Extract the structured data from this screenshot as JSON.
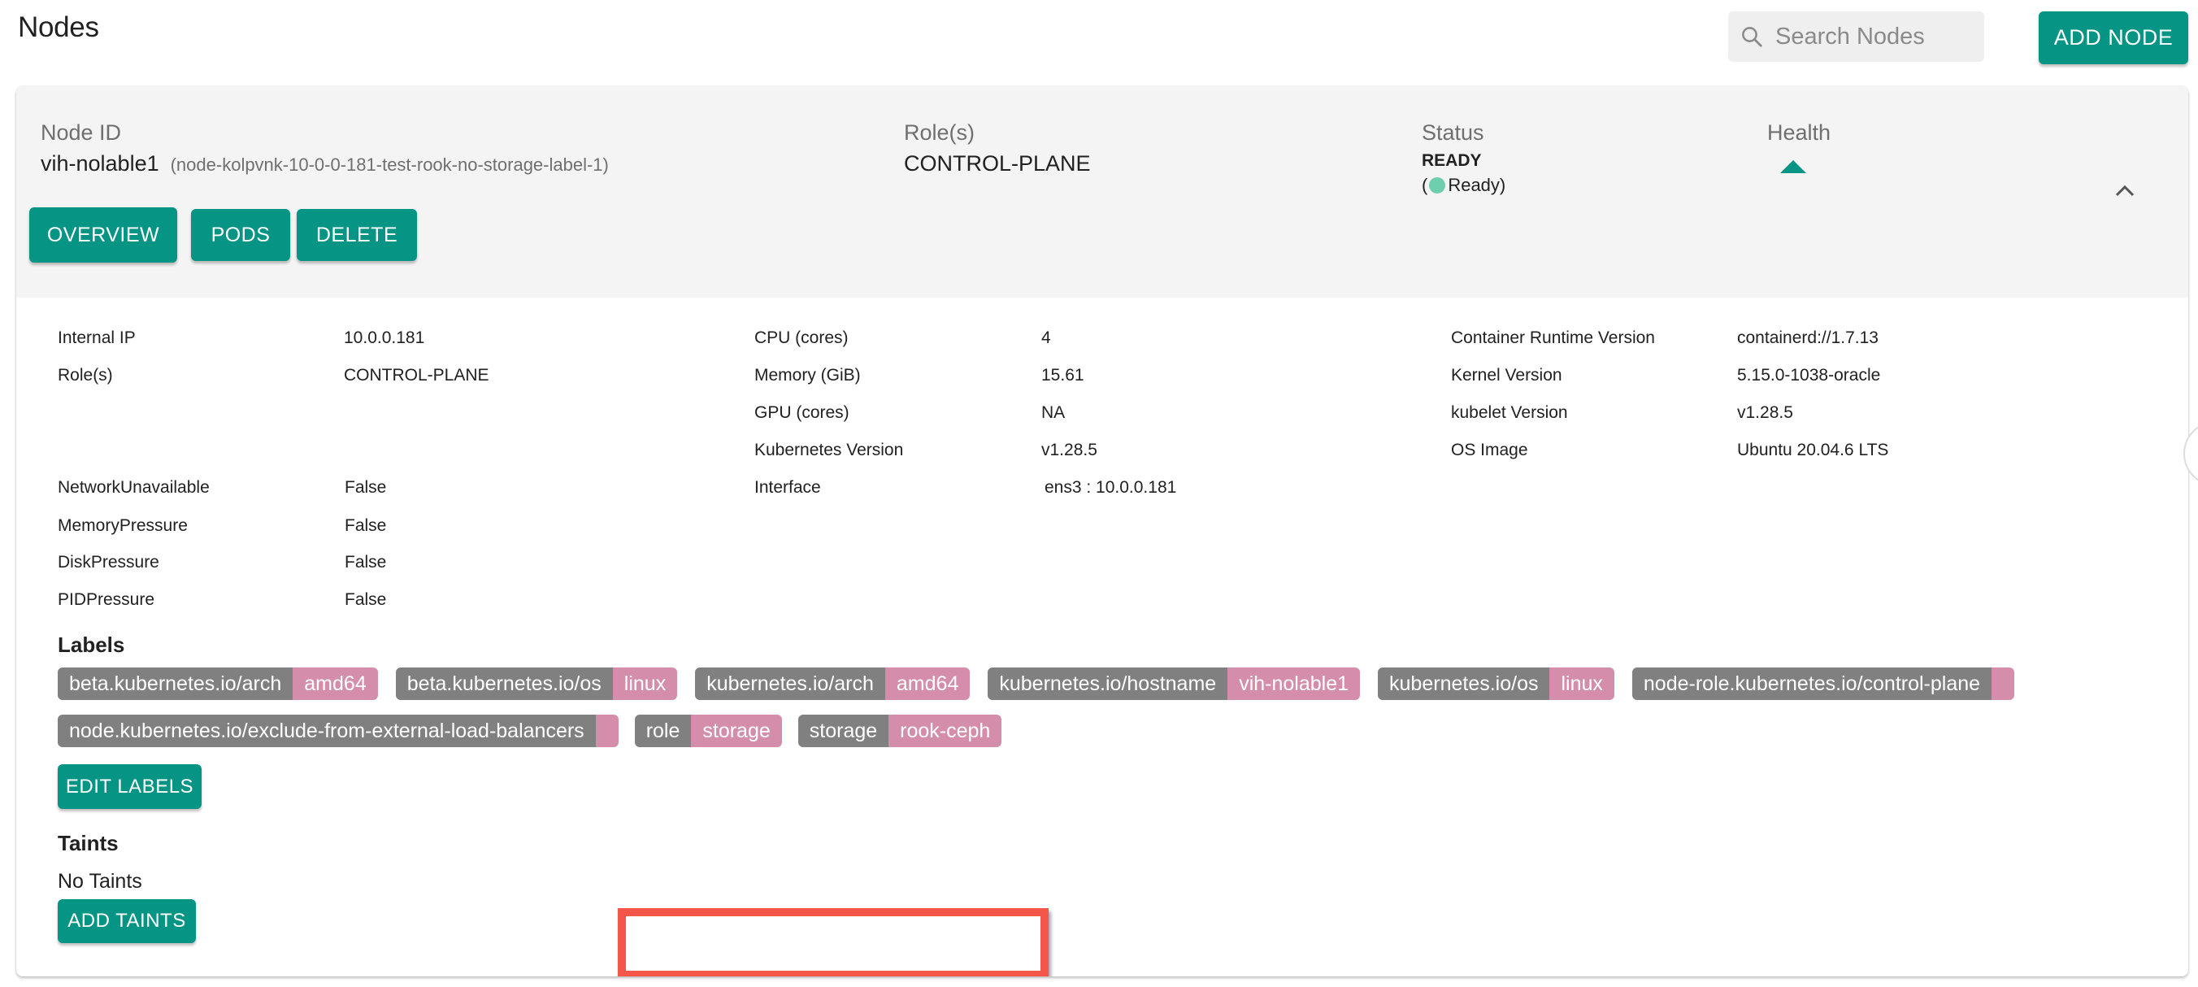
{
  "page": {
    "title": "Nodes",
    "search": {
      "placeholder": "Search Nodes",
      "value": ""
    },
    "add_node_label": "ADD NODE"
  },
  "node": {
    "header": {
      "node_id_label": "Node ID",
      "node_id": "vih-nolable1",
      "node_full_name": "(node-kolpvnk-10-0-0-181-test-rook-no-storage-label-1)",
      "roles_label": "Role(s)",
      "roles": "CONTROL-PLANE",
      "status_label": "Status",
      "status": "READY",
      "status_detail_open": "(",
      "status_detail": "Ready)",
      "status_color": "#6dcfae",
      "health_label": "Health",
      "health_icon": "triangle-up-icon",
      "health_color": "#069484",
      "expanded": true
    },
    "actions": {
      "overview": "OVERVIEW",
      "pods": "PODS",
      "delete": "DELETE"
    },
    "details": {
      "col1": [
        {
          "label": "Internal IP",
          "value": "10.0.0.181"
        },
        {
          "label": "Role(s)",
          "value": "CONTROL-PLANE"
        },
        {
          "label": "NetworkUnavailable",
          "value": "False"
        },
        {
          "label": "MemoryPressure",
          "value": "False"
        },
        {
          "label": "DiskPressure",
          "value": "False"
        },
        {
          "label": "PIDPressure",
          "value": "False"
        }
      ],
      "col2": [
        {
          "label": "CPU (cores)",
          "value": "4"
        },
        {
          "label": "Memory (GiB)",
          "value": "15.61"
        },
        {
          "label": "GPU (cores)",
          "value": "NA"
        },
        {
          "label": "Kubernetes Version",
          "value": "v1.28.5"
        },
        {
          "label": "Interface",
          "value": "ens3 : 10.0.0.181"
        }
      ],
      "col3": [
        {
          "label": "Container Runtime Version",
          "value": "containerd://1.7.13"
        },
        {
          "label": "Kernel Version",
          "value": "5.15.0-1038-oracle"
        },
        {
          "label": "kubelet Version",
          "value": "v1.28.5"
        },
        {
          "label": "OS Image",
          "value": "Ubuntu 20.04.6 LTS"
        }
      ]
    },
    "labels": {
      "title": "Labels",
      "items": [
        {
          "key": "beta.kubernetes.io/arch",
          "value": "amd64"
        },
        {
          "key": "beta.kubernetes.io/os",
          "value": "linux"
        },
        {
          "key": "kubernetes.io/arch",
          "value": "amd64"
        },
        {
          "key": "kubernetes.io/hostname",
          "value": "vih-nolable1"
        },
        {
          "key": "kubernetes.io/os",
          "value": "linux"
        },
        {
          "key": "node-role.kubernetes.io/control-plane",
          "value": ""
        },
        {
          "key": "node.kubernetes.io/exclude-from-external-load-balancers",
          "value": ""
        },
        {
          "key": "role",
          "value": "storage"
        },
        {
          "key": "storage",
          "value": "rook-ceph"
        }
      ],
      "highlighted_keys": [
        "role",
        "storage"
      ],
      "highlight_color": "#f4574a",
      "edit_label": "EDIT LABELS"
    },
    "taints": {
      "title": "Taints",
      "empty_text": "No Taints",
      "add_label": "ADD TAINTS"
    }
  },
  "colors": {
    "accent": "#069484",
    "label_key_bg": "#808080",
    "label_value_bg": "#d48eab",
    "header_bg": "#f4f4f4"
  }
}
